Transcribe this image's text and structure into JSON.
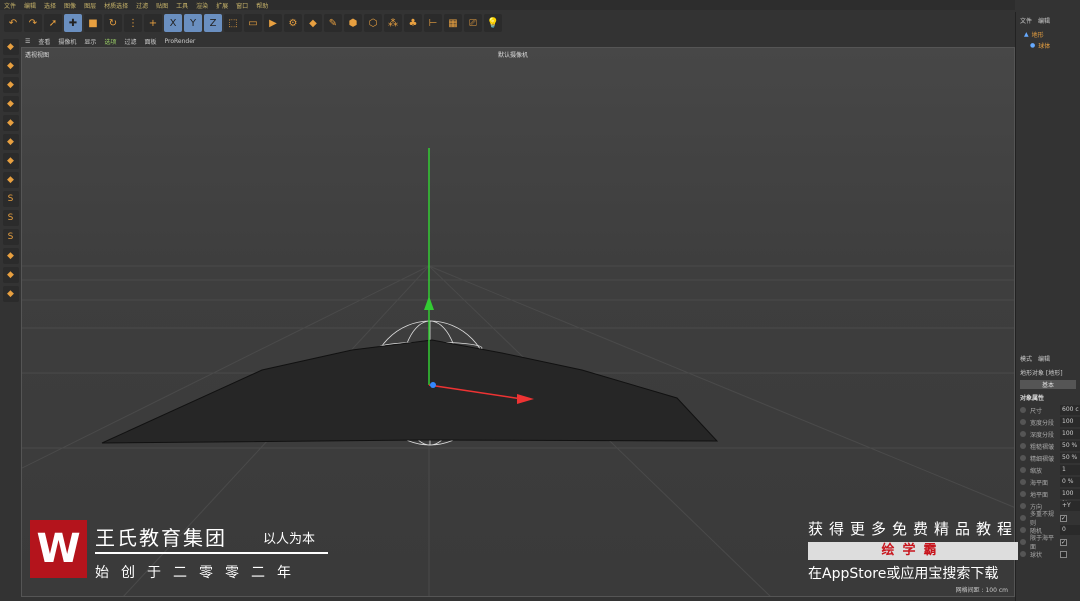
{
  "menu": [
    "文件",
    "编辑",
    "选择",
    "图像",
    "图层",
    "材质选择",
    "过滤",
    "贴图",
    "工具",
    "渲染",
    "扩展",
    "窗口",
    "帮助"
  ],
  "toolbar_icons": [
    "undo-icon",
    "redo-icon",
    "live-select-icon",
    "move-icon",
    "scale-icon",
    "rotate-icon",
    "recent-tools-icon",
    "add-icon",
    "x-axis-icon",
    "y-axis-icon",
    "z-axis-icon",
    "world-coord-icon",
    "render-view-icon",
    "render-picture-viewer-icon",
    "render-settings-icon",
    "cube-icon",
    "pen-icon",
    "subdivision-icon",
    "array-icon",
    "cloner-icon",
    "mograph-icon",
    "deformer-icon",
    "floor-icon",
    "camera-icon",
    "light-icon"
  ],
  "viewport": {
    "menu": [
      "查看",
      "摄像机",
      "显示",
      "选项",
      "过滤",
      "面板",
      "ProRender"
    ],
    "title": "透视视图",
    "camera": "默认摄像机",
    "grid_spacing": "网格间距 : 100 cm"
  },
  "objects": {
    "header": [
      "文件",
      "编辑"
    ],
    "items": [
      "地形",
      "球体"
    ]
  },
  "attributes": {
    "header": [
      "模式",
      "编辑"
    ],
    "object_title": "地形对象 [地形]",
    "tab": "基本",
    "section": "对象属性",
    "fields": [
      {
        "label": "尺寸",
        "value": "600 c"
      },
      {
        "label": "宽度分段",
        "value": "100"
      },
      {
        "label": "深度分段",
        "value": "100"
      },
      {
        "label": "粗糙褶皱",
        "value": "50 %"
      },
      {
        "label": "精细褶皱",
        "value": "50 %"
      },
      {
        "label": "缩放",
        "value": "1"
      },
      {
        "label": "海平面",
        "value": "0 %"
      },
      {
        "label": "地平面",
        "value": "100 %"
      },
      {
        "label": "方向",
        "value": "+Y"
      }
    ],
    "checks": [
      {
        "label": "多重不规则",
        "checked": true
      },
      {
        "label": "随机",
        "value": "0"
      },
      {
        "label": "限于海平面",
        "checked": true
      },
      {
        "label": "球状",
        "checked": false
      }
    ]
  },
  "watermark": {
    "logo": "W",
    "name": "王氏教育集团",
    "motto": "以人为本",
    "since": "始创于二零零二年",
    "promo": "获得更多免费精品教程",
    "brand": "绘学霸",
    "download": "在AppStore或应用宝搜索下载"
  }
}
